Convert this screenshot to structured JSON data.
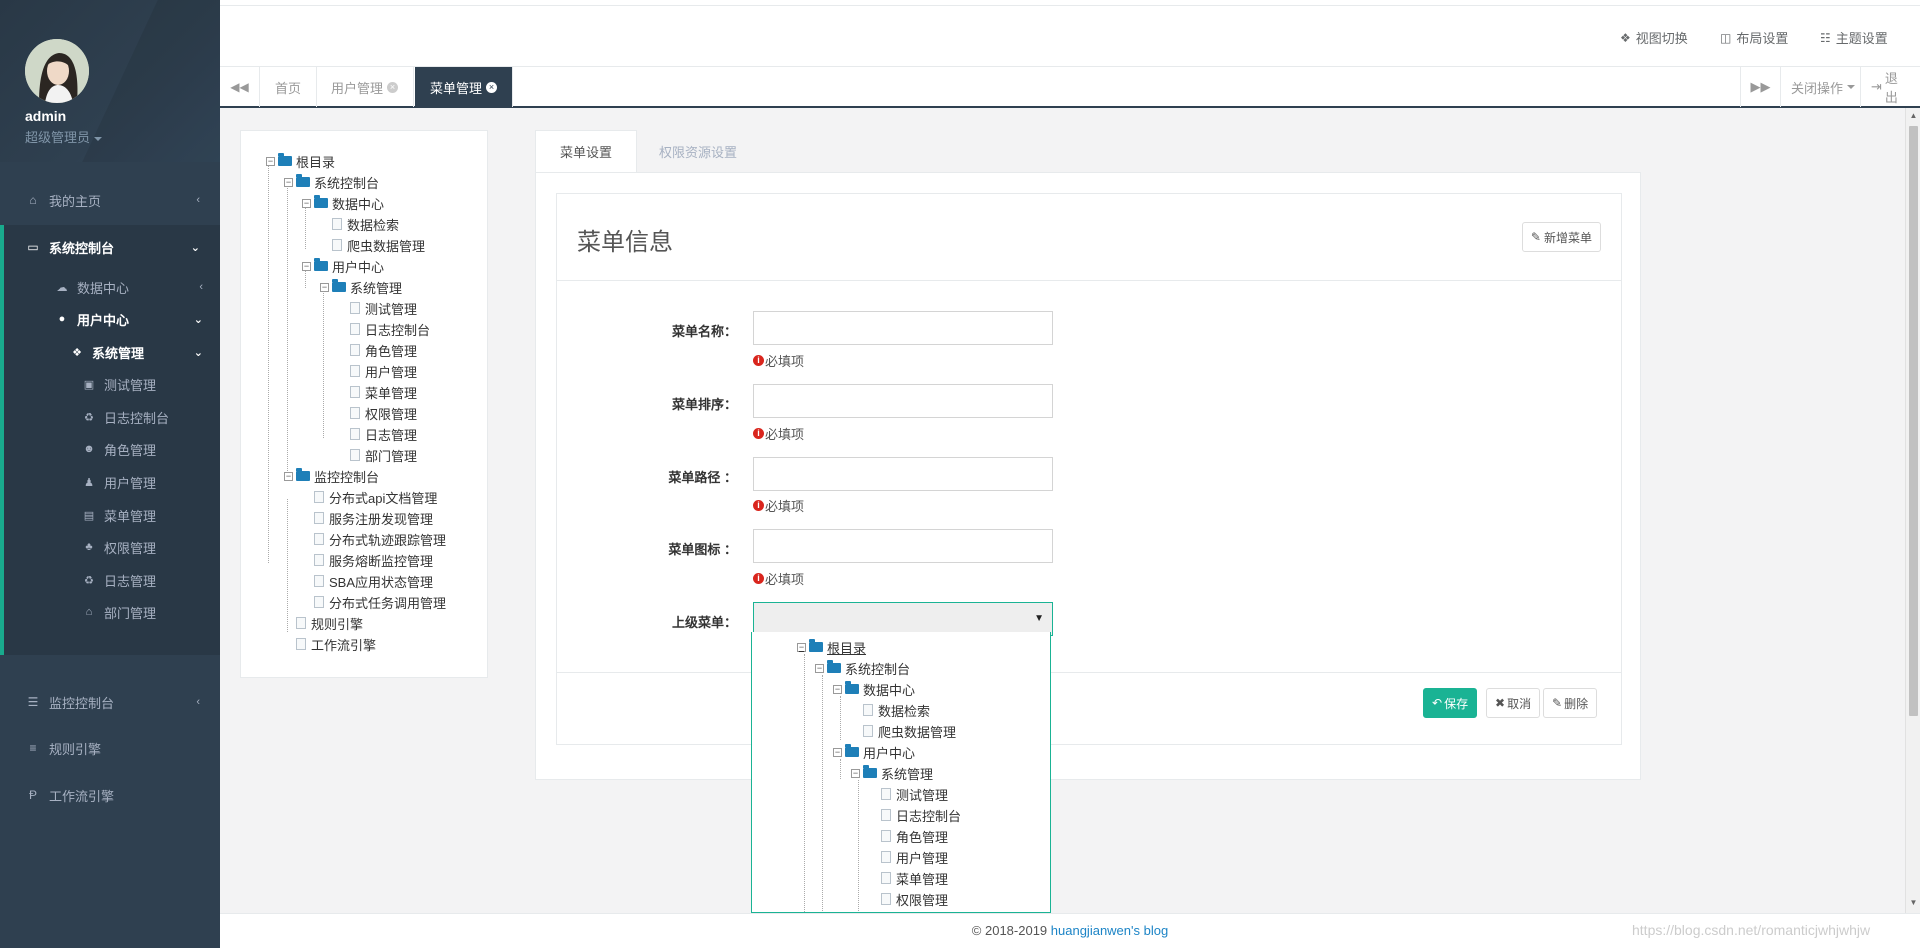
{
  "sidebar": {
    "username": "admin",
    "role": "超级管理员",
    "menu": {
      "home": "我的主页",
      "console": "系统控制台",
      "data_center": "数据中心",
      "user_center": "用户中心",
      "sys_manage": "系统管理",
      "test_manage": "测试管理",
      "log_console": "日志控制台",
      "role_manage": "角色管理",
      "user_manage": "用户管理",
      "menu_manage": "菜单管理",
      "perm_manage": "权限管理",
      "log_manage": "日志管理",
      "dept_manage": "部门管理",
      "monitor": "监控控制台",
      "rule_engine": "规则引擎",
      "workflow_engine": "工作流引擎"
    }
  },
  "header": {
    "view_switch": "视图切换",
    "layout_settings": "布局设置",
    "theme_settings": "主题设置"
  },
  "tabs": {
    "home": "首页",
    "user_manage": "用户管理",
    "menu_manage": "菜单管理",
    "close_ops": "关闭操作",
    "logout": "退出"
  },
  "tree": {
    "root": "根目录",
    "console": "系统控制台",
    "data_center": "数据中心",
    "data_search": "数据检索",
    "crawler_data": "爬虫数据管理",
    "user_center": "用户中心",
    "sys_manage": "系统管理",
    "test_manage": "测试管理",
    "log_console": "日志控制台",
    "role_manage": "角色管理",
    "user_manage": "用户管理",
    "menu_manage": "菜单管理",
    "perm_manage": "权限管理",
    "log_manage": "日志管理",
    "dept_manage": "部门管理",
    "monitor": "监控控制台",
    "api_doc": "分布式api文档管理",
    "service_reg": "服务注册发现管理",
    "trace": "分布式轨迹跟踪管理",
    "circuit": "服务熔断监控管理",
    "sba": "SBA应用状态管理",
    "task_sched": "分布式任务调用管理",
    "rule_engine": "规则引擎",
    "workflow_engine": "工作流引擎"
  },
  "form": {
    "tab_menu": "菜单设置",
    "tab_perm": "权限资源设置",
    "title": "菜单信息",
    "new_menu": "新增菜单",
    "label_name": "菜单名称：",
    "label_order": "菜单排序：",
    "label_path": "菜单路径 ：",
    "label_icon": "菜单图标 ：",
    "label_parent": "上级菜单：",
    "required": "必填项",
    "save": "保存",
    "cancel": "取消",
    "delete": "删除"
  },
  "footer": {
    "copyright": "© 2018-2019",
    "blog": "huangjianwen's blog",
    "watermark": "https://blog.csdn.net/romanticjwhjwhjw"
  },
  "colors": {
    "sidebar": "#2f4050",
    "accent": "#1ab394",
    "link": "#1c84c6",
    "folder": "#1e7fb8"
  }
}
